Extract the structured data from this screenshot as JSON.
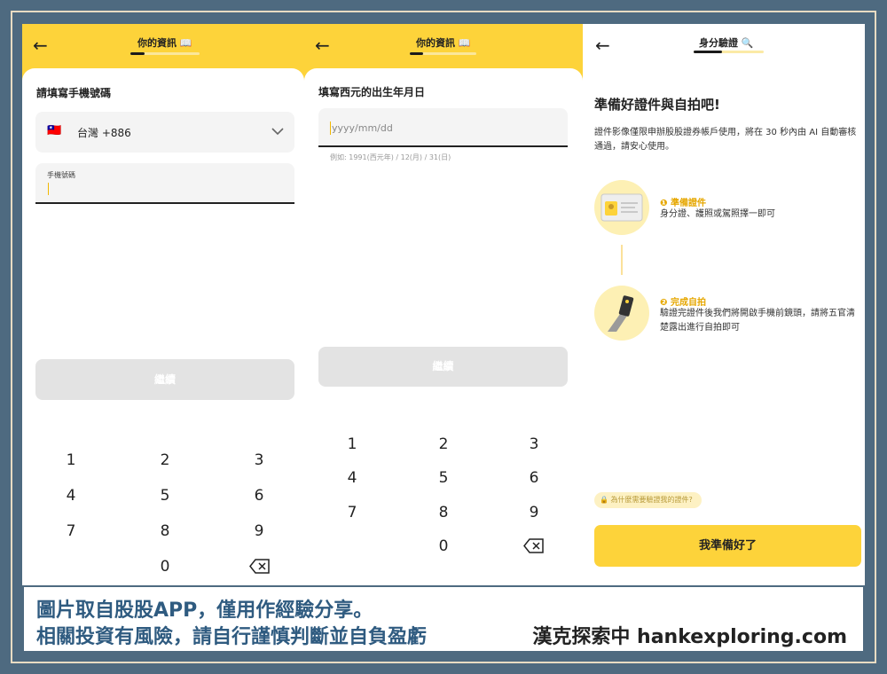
{
  "screens": [
    {
      "header_title": "你的資訊 📖",
      "progress": 0.2,
      "question": "請填寫手機號碼",
      "country": {
        "flag": "🇹🇼",
        "label": "台灣 +886"
      },
      "phone_label": "手機號碼",
      "continue_label": "繼續",
      "keypad": [
        "1",
        "2",
        "3",
        "4",
        "5",
        "6",
        "7",
        "8",
        "9",
        "0"
      ]
    },
    {
      "header_title": "你的資訊 📖",
      "progress": 0.2,
      "question": "填寫西元的出生年月日",
      "date_placeholder": "yyyy/mm/dd",
      "date_hint": "例如: 1991(西元年) / 12(月) / 31(日)",
      "continue_label": "繼續",
      "keypad": [
        "1",
        "2",
        "3",
        "4",
        "5",
        "6",
        "7",
        "8",
        "9",
        "0"
      ]
    },
    {
      "header_title": "身分驗證 🔍",
      "progress": 0.4,
      "heading": "準備好證件與自拍吧!",
      "intro": "證件影像僅限申辦股股證券帳戶使用，將在 30 秒內由 AI 自動審核通過，請安心使用。",
      "steps": [
        {
          "number": "❶",
          "title": "準備證件",
          "desc": "身分證、護照或駕照擇一即可"
        },
        {
          "number": "❷",
          "title": "完成自拍",
          "desc": "驗證完證件後我們將開啟手機前鏡頭，請將五官清楚露出進行自拍即可"
        }
      ],
      "why_label": "為什麼需要驗證我的證件?",
      "ready_label": "我準備好了"
    }
  ],
  "caption": {
    "line1": "圖片取自股股APP，僅用作經驗分享。",
    "line2": "相關投資有風險，請自行謹慎判斷並自負盈虧",
    "credit": "漢克探索中 hankexploring.com"
  },
  "colors": {
    "accent": "#fdd33a",
    "caption_text": "#2f5b80",
    "background": "#4e6a80"
  }
}
